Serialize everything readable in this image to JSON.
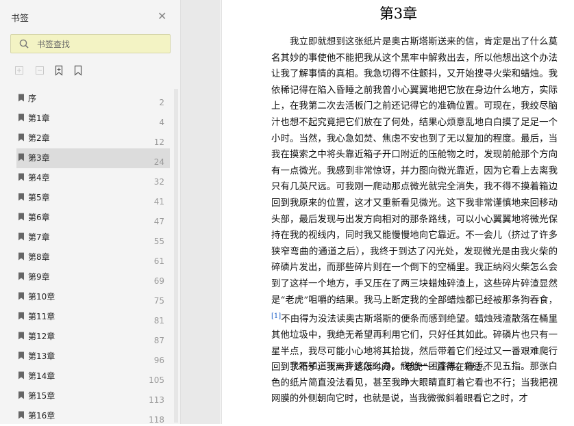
{
  "sidebar": {
    "title": "书签",
    "search": {
      "placeholder": "书签查找",
      "value": ""
    },
    "items": [
      {
        "label": "序",
        "page": "2"
      },
      {
        "label": "第1章",
        "page": "4"
      },
      {
        "label": "第2章",
        "page": "12"
      },
      {
        "label": "第3章",
        "page": "24"
      },
      {
        "label": "第4章",
        "page": "32"
      },
      {
        "label": "第5章",
        "page": "41"
      },
      {
        "label": "第6章",
        "page": "47"
      },
      {
        "label": "第7章",
        "page": "55"
      },
      {
        "label": "第8章",
        "page": "61"
      },
      {
        "label": "第9章",
        "page": "69"
      },
      {
        "label": "第10章",
        "page": "75"
      },
      {
        "label": "第11章",
        "page": "81"
      },
      {
        "label": "第12章",
        "page": "87"
      },
      {
        "label": "第13章",
        "page": "96"
      },
      {
        "label": "第14章",
        "page": "105"
      },
      {
        "label": "第15章",
        "page": "113"
      },
      {
        "label": "第16章",
        "page": "118"
      }
    ],
    "active_index": 3
  },
  "document": {
    "chapter_title": "第3章",
    "p1_before": "我立即就想到这张纸片是奥古斯塔斯送来的信，肯定是出了什么莫名其妙的事使他不能把我从这个黑牢中解救出去，所以他想出这个办法让我了解事情的真相。我急切得不住颤抖，又开始搜寻火柴和蜡烛。我依稀记得在陷入昏睡之前我曾小心翼翼地把它放在身边什么地方，实际上，在我第二次去活板门之前还记得它的准确位置。可现在，我绞尽脑汁也想不起究竟把它们放在了何处，结果心烦意乱地白白摸了足足一个小时。当然，我心急如焚、焦虑不安也到了无以复加的程度。最后，当我在摸索之中将头靠近箱子开口附近的压舱物之时，发现前舱那个方向有一点微光。我感到非常惊讶，并力图向微光靠近，因为它看上去离我只有几英尺远。可我刚一爬动那点微光就完全消失，我不得不摸着箱边回到我原来的位置，这才又重新看见微光。这下我非常谨慎地来回移动头部，最后发现与出发方向相对的那条路线，可以小心翼翼地将微光保持在我的视线内，同时我又能慢慢地向它靠近。不一会儿（挤过了许多狭窄弯曲的通道之后），我终于到达了闪光处，发现微光是由我火柴的碎磷片发出，而那些碎片则在一个倒下的空桶里。我正纳闷火柴怎么会到了这样一个地方，手又压在了两三块蜡烛碎渣上，这些碎片碎渣显然是“老虎”咀嚼的结果。我马上断定我的全部蜡烛都已经被那条狗吞食，",
    "footnote": "[1]",
    "p1_after": "不由得为没法读奥古斯塔斯的便条而感到绝望。蜡烛残渣散落在桶里其他垃圾中，我绝无希望再利用它们，只好任其如此。碎磷片也只有一星半点，我尽可能小心地将其拾拢，然后带着它们经过又一番艰难爬行回到了箱子。我离开这段时间，“老虎”一直待在箱边。",
    "p2": "我不知道下一步该怎么办。底舱一团漆黑，伸手不见五指。那张白色的纸片简直没法看见，甚至我睁大眼睛直盯着它看也不行；当我把视网膜的外侧朝向它时，也就是说，当我微微斜着眼看它之时，才"
  }
}
